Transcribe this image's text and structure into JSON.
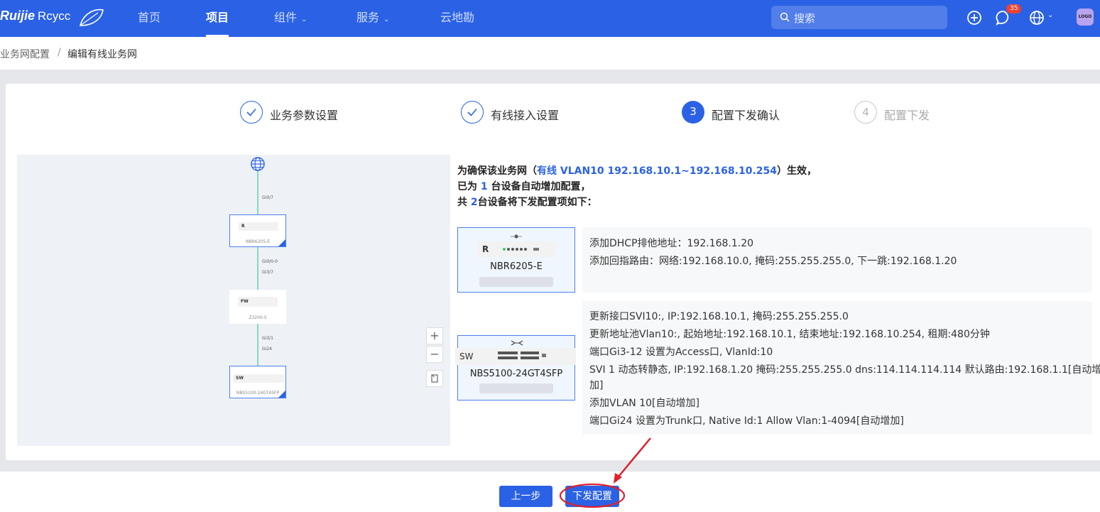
{
  "topbar": {
    "logo_brand": "Ruijie",
    "logo_sub": "Rcycc",
    "nav": [
      "首页",
      "项目",
      "组件",
      "服务",
      "云地勘"
    ],
    "search_placeholder": "搜索",
    "notification_count": "35",
    "avatar_text": "LOGO"
  },
  "breadcrumb": {
    "parent": "业务网配置",
    "separator": "/",
    "current": "编辑有线业务网"
  },
  "steps": [
    {
      "num": "",
      "label": "业务参数设置",
      "state": "done"
    },
    {
      "num": "",
      "label": "有线接入设置",
      "state": "done"
    },
    {
      "num": "3",
      "label": "配置下发确认",
      "state": "active"
    },
    {
      "num": "4",
      "label": "配置下发",
      "state": "todo"
    }
  ],
  "topology": {
    "nodes": [
      {
        "name": "NBR6205-E",
        "type": "R"
      },
      {
        "name": "Z3200-S",
        "type": "FW"
      },
      {
        "name": "NBS5100-24GT4SFP",
        "type": "SW"
      }
    ],
    "ports": {
      "p1": "Gi0/7",
      "p2": "Gi0/0-0",
      "p3": "Gi3/7",
      "p4": "Gi3/1",
      "p5": "Gi24"
    },
    "zoom_in": "+",
    "zoom_out": "−"
  },
  "summary": {
    "l1_a": "为确保该业务网（",
    "l1_hl": "有线 VLAN10 192.168.10.1~192.168.10.254",
    "l1_b": "）生效，",
    "l2_a": "已为 ",
    "l2_hl": "1",
    "l2_b": " 台设备自动增加配置，",
    "l3_a": "共 ",
    "l3_hl": "2",
    "l3_b": "台设备将下发配置项如下："
  },
  "devices": [
    {
      "type": "R",
      "name": "NBR6205-E",
      "configs": [
        "添加DHCP排他地址：192.168.1.20",
        "添加回指路由：网络:192.168.10.0, 掩码:255.255.255.0, 下一跳:192.168.1.20"
      ]
    },
    {
      "type": "SW",
      "name": "NBS5100-24GT4SFP",
      "configs": [
        "更新接口SVI10:, IP:192.168.10.1, 掩码:255.255.255.0",
        "更新地址池Vlan10:, 起始地址:192.168.10.1, 结束地址:192.168.10.254, 租期:480分钟",
        "端口Gi3-12 设置为Access口, VlanId:10",
        "SVI 1 动态转静态, IP:192.168.1.20 掩码:255.255.255.0 dns:114.114.114.114 默认路由:192.168.1.1[自动增",
        "加]",
        "添加VLAN 10[自动增加]",
        "端口Gi24 设置为Trunk口, Native Id:1 Allow Vlan:1-4094[自动增加]"
      ]
    }
  ],
  "buttons": {
    "prev": "上一步",
    "submit": "下发配置"
  },
  "colors": {
    "primary": "#2b62e5",
    "annotation": "#e0202a",
    "badge": "#f04134"
  }
}
